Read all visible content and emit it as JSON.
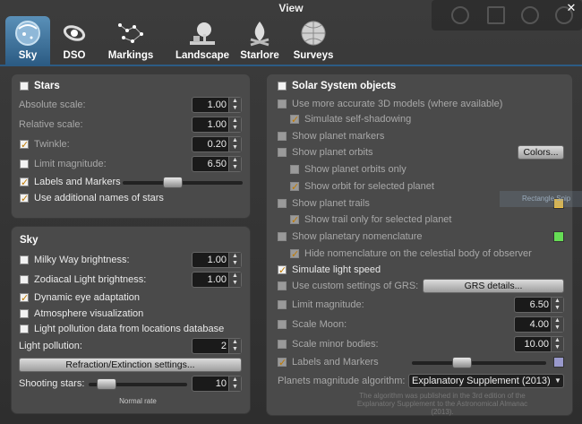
{
  "window": {
    "title": "View",
    "close_glyph": "✕"
  },
  "tabs": [
    {
      "label": "Sky",
      "icon": "sky-icon",
      "active": true
    },
    {
      "label": "DSO",
      "icon": "galaxy-icon",
      "active": false
    },
    {
      "label": "Markings",
      "icon": "constellation-icon",
      "active": false
    },
    {
      "label": "Landscape",
      "icon": "tree-icon",
      "active": false
    },
    {
      "label": "Starlore",
      "icon": "campfire-icon",
      "active": false
    },
    {
      "label": "Surveys",
      "icon": "globe-icon",
      "active": false
    }
  ],
  "stars": {
    "header": "Stars",
    "absolute_scale_label": "Absolute scale:",
    "absolute_scale_value": "1.00",
    "relative_scale_label": "Relative scale:",
    "relative_scale_value": "1.00",
    "twinkle_label": "Twinkle:",
    "twinkle_value": "0.20",
    "limit_mag_label": "Limit magnitude:",
    "limit_mag_value": "6.50",
    "labels_markers_label": "Labels and Markers",
    "labels_markers_slider": 0.4,
    "additional_names_label": "Use additional names of stars"
  },
  "sky": {
    "header": "Sky",
    "milky_way_label": "Milky Way brightness:",
    "milky_way_value": "1.00",
    "zodiacal_label": "Zodiacal Light brightness:",
    "zodiacal_value": "1.00",
    "dynamic_eye_label": "Dynamic eye adaptation",
    "atmosphere_label": "Atmosphere visualization",
    "light_pollution_db_label": "Light pollution data from locations database",
    "light_pollution_label": "Light pollution:",
    "light_pollution_value": "2",
    "refraction_button": "Refraction/Extinction settings...",
    "shooting_stars_label": "Shooting stars:",
    "shooting_stars_value": "10",
    "shooting_stars_slider": 0.1,
    "normal_rate": "Normal rate"
  },
  "solar": {
    "header": "Solar System objects",
    "models_label": "Use more accurate 3D models (where available)",
    "self_shadow_label": "Simulate self-shadowing",
    "markers_label": "Show planet markers",
    "orbits_label": "Show planet orbits",
    "colors_button": "Colors...",
    "orbits_only_label": "Show planet orbits only",
    "orbit_selected_label": "Show orbit for selected planet",
    "trails_label": "Show planet trails",
    "trail_selected_label": "Show trail only for selected planet",
    "nomenclature_label": "Show planetary nomenclature",
    "hide_nomenclature_label": "Hide nomenclature on the celestial body of observer",
    "light_speed_label": "Simulate light speed",
    "grs_label": "Use custom settings of GRS:",
    "grs_button": "GRS details...",
    "limit_mag_label": "Limit magnitude:",
    "limit_mag_value": "6.50",
    "scale_moon_label": "Scale Moon:",
    "scale_moon_value": "4.00",
    "scale_minor_label": "Scale minor bodies:",
    "scale_minor_value": "10.00",
    "labels_markers_label": "Labels and Markers",
    "labels_markers_slider": 0.35,
    "magnitude_algo_label": "Planets magnitude algorithm:",
    "magnitude_algo_value": "Explanatory Supplement (2013)",
    "algo_note": "The algorithm was published in the 3rd edition of the Explanatory Supplement to the Astronomical Almanac (2013).",
    "trail_color": "#f0c040",
    "nomenclature_color": "#66dd55",
    "labels_color": "#9999cc"
  },
  "ghost": {
    "rectangle_label": "Rectangle Snip"
  },
  "colors": {
    "accent": "#2c5c84",
    "panel": "#4a4a4a",
    "check": "#c07a00"
  }
}
